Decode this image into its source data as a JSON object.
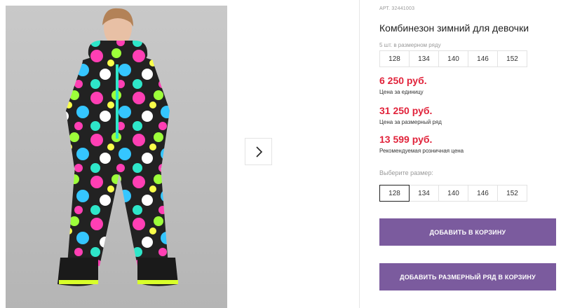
{
  "gallery": {
    "photo_alt": "Комбинезон зимний для девочки",
    "next_icon": "chevron-right-icon"
  },
  "product": {
    "sku": "АРТ. 32441003",
    "title": "Комбинезон зимний для девочки",
    "range_label": "5 шт. в размерном ряду",
    "range_sizes": [
      "128",
      "134",
      "140",
      "146",
      "152"
    ],
    "prices": [
      {
        "value": "6 250 руб.",
        "note": "Цена за единицу"
      },
      {
        "value": "31 250 руб.",
        "note": "Цена за размерный ряд"
      },
      {
        "value": "13 599 руб.",
        "note": "Рекомендуемая розничная цена"
      }
    ],
    "choose_label": "Выберите размер:",
    "select_sizes": [
      "128",
      "134",
      "140",
      "146",
      "152"
    ],
    "selected_size": "128",
    "add_to_cart": "Добавить в корзину",
    "add_range_to_cart": "Добавить размерный ряд в корзину"
  },
  "colors": {
    "accent": "#7b5b9e",
    "price": "#e1233b"
  }
}
